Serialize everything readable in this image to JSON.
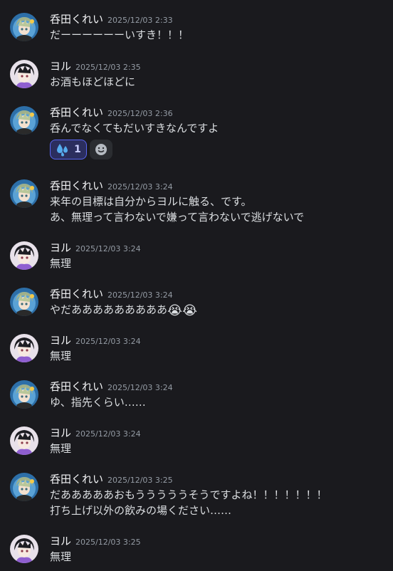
{
  "users": {
    "kurei": "呑田くれい",
    "yoru": "ヨル"
  },
  "messages": [
    {
      "author": "呑田くれい",
      "time": "2025/12/03 2:33",
      "lines": [
        "だーーーーーーいすき！！！"
      ]
    },
    {
      "author": "ヨル",
      "time": "2025/12/03 2:35",
      "lines": [
        "お酒もほどほどに"
      ]
    },
    {
      "author": "呑田くれい",
      "time": "2025/12/03 2:36",
      "lines": [
        "呑んでなくてもだいすきなんですよ"
      ],
      "reaction": {
        "emoji": "sweat-drops",
        "count": "1"
      }
    },
    {
      "author": "呑田くれい",
      "time": "2025/12/03 3:24",
      "lines": [
        "来年の目標は自分からヨルに触る、です。",
        "あ、無理って言わないで嫌って言わないで逃げないで"
      ]
    },
    {
      "author": "ヨル",
      "time": "2025/12/03 3:24",
      "lines": [
        "無理"
      ]
    },
    {
      "author": "呑田くれい",
      "time": "2025/12/03 3:24",
      "lines": [
        "やだあああああああああ"
      ],
      "trailing_emoji": "😭😭"
    },
    {
      "author": "ヨル",
      "time": "2025/12/03 3:24",
      "lines": [
        "無理"
      ]
    },
    {
      "author": "呑田くれい",
      "time": "2025/12/03 3:24",
      "lines": [
        "ゆ、指先くらい……"
      ]
    },
    {
      "author": "ヨル",
      "time": "2025/12/03 3:24",
      "lines": [
        "無理"
      ]
    },
    {
      "author": "呑田くれい",
      "time": "2025/12/03 3:25",
      "lines": [
        "だあああああおもうううううそうですよね！！！！！！！",
        "打ち上げ以外の飲みの場ください……"
      ]
    },
    {
      "author": "ヨル",
      "time": "2025/12/03 3:25",
      "lines": [
        "無理"
      ]
    }
  ],
  "colors": {
    "background": "#1a1a1e",
    "reaction_active_bg": "#2b2e5e",
    "reaction_active_border": "#5865f2"
  }
}
